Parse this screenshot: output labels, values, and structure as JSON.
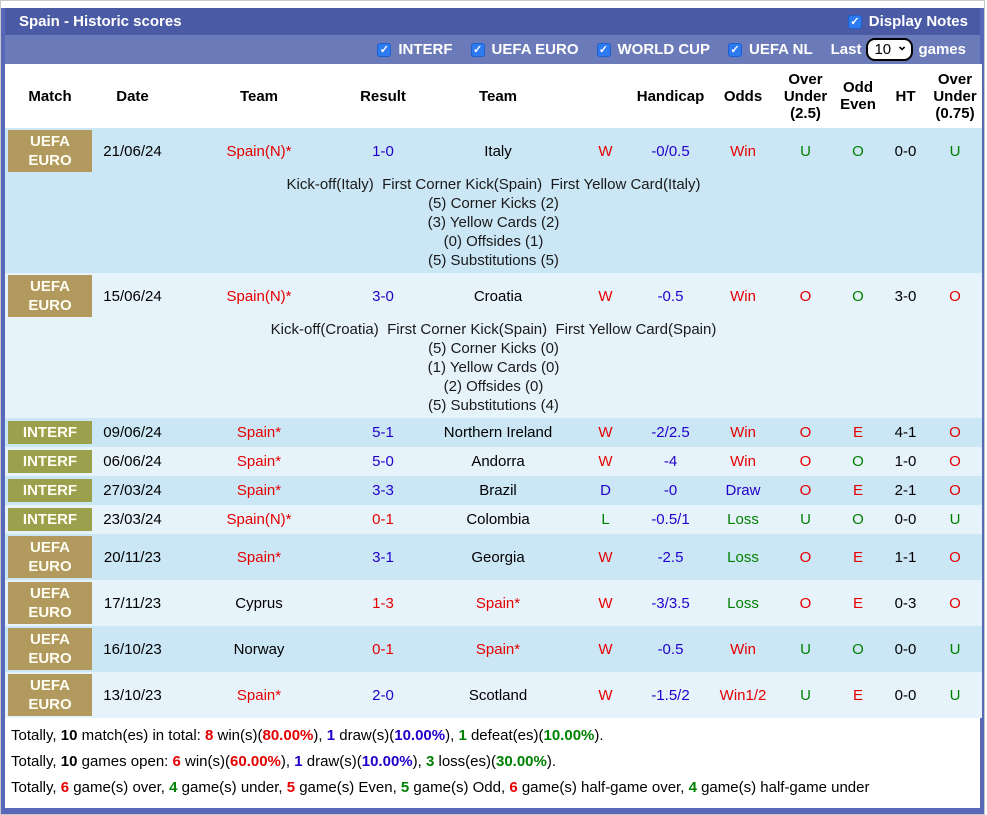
{
  "palette": {
    "r": "#e50000",
    "b": "#2200cc",
    "g": "#008000",
    "k": "#000000",
    "title_bar_bg": "#4a5aa5",
    "filter_bar_bg": "#6b7ab8",
    "border_blue": "#5868b8",
    "checkbox_blue": "#2e7bf0",
    "row_dark": "#cbe6f5",
    "row_light": "#e7f3fb",
    "badge_euro": "#b2995e",
    "badge_interf": "#9aa04b"
  },
  "header": {
    "title": "Spain - Historic scores",
    "display_notes_label": "Display Notes"
  },
  "filters": {
    "items": [
      "INTERF",
      "UEFA EURO",
      "WORLD CUP",
      "UEFA NL"
    ],
    "last_label": "Last",
    "last_value": "10",
    "games_label": "games"
  },
  "table": {
    "columns": [
      "Match",
      "Date",
      "Team",
      "Result",
      "Team",
      "",
      "Handicap",
      "Odds",
      "Over\nUnder\n(2.5)",
      "Odd\nEven",
      "HT",
      "Over\nUnder\n(0.75)"
    ]
  },
  "rows": [
    {
      "comp": "UEFA EURO",
      "comp_style": "euro",
      "shade": "dark",
      "date": "21/06/24",
      "team1": [
        "Spain(N)*",
        "r"
      ],
      "result": [
        "1-0",
        "b"
      ],
      "team2": [
        "Italy",
        "k"
      ],
      "wdl": [
        "W",
        "r"
      ],
      "handicap": [
        "-0/0.5",
        "b"
      ],
      "odds": [
        "Win",
        "r"
      ],
      "ou25": [
        "U",
        "g"
      ],
      "oe": [
        "O",
        "g"
      ],
      "ht": [
        "0-0",
        "k"
      ],
      "ou075": [
        "U",
        "g"
      ],
      "notes": [
        "Kick-off(Italy)  First Corner Kick(Spain)  First Yellow Card(Italy)",
        "(5) Corner Kicks (2)",
        "(3) Yellow Cards (2)",
        "(0) Offsides (1)",
        "(5) Substitutions (5)"
      ]
    },
    {
      "comp": "UEFA EURO",
      "comp_style": "euro",
      "shade": "light",
      "date": "15/06/24",
      "team1": [
        "Spain(N)*",
        "r"
      ],
      "result": [
        "3-0",
        "b"
      ],
      "team2": [
        "Croatia",
        "k"
      ],
      "wdl": [
        "W",
        "r"
      ],
      "handicap": [
        "-0.5",
        "b"
      ],
      "odds": [
        "Win",
        "r"
      ],
      "ou25": [
        "O",
        "r"
      ],
      "oe": [
        "O",
        "g"
      ],
      "ht": [
        "3-0",
        "k"
      ],
      "ou075": [
        "O",
        "r"
      ],
      "notes": [
        "Kick-off(Croatia)  First Corner Kick(Spain)  First Yellow Card(Spain)",
        "(5) Corner Kicks (0)",
        "(1) Yellow Cards (0)",
        "(2) Offsides (0)",
        "(5) Substitutions (4)"
      ]
    },
    {
      "comp": "INTERF",
      "comp_style": "interf",
      "shade": "dark",
      "date": "09/06/24",
      "team1": [
        "Spain*",
        "r"
      ],
      "result": [
        "5-1",
        "b"
      ],
      "team2": [
        "Northern Ireland",
        "k"
      ],
      "wdl": [
        "W",
        "r"
      ],
      "handicap": [
        "-2/2.5",
        "b"
      ],
      "odds": [
        "Win",
        "r"
      ],
      "ou25": [
        "O",
        "r"
      ],
      "oe": [
        "E",
        "r"
      ],
      "ht": [
        "4-1",
        "k"
      ],
      "ou075": [
        "O",
        "r"
      ],
      "notes": []
    },
    {
      "comp": "INTERF",
      "comp_style": "interf",
      "shade": "light",
      "date": "06/06/24",
      "team1": [
        "Spain*",
        "r"
      ],
      "result": [
        "5-0",
        "b"
      ],
      "team2": [
        "Andorra",
        "k"
      ],
      "wdl": [
        "W",
        "r"
      ],
      "handicap": [
        "-4",
        "b"
      ],
      "odds": [
        "Win",
        "r"
      ],
      "ou25": [
        "O",
        "r"
      ],
      "oe": [
        "O",
        "g"
      ],
      "ht": [
        "1-0",
        "k"
      ],
      "ou075": [
        "O",
        "r"
      ],
      "notes": []
    },
    {
      "comp": "INTERF",
      "comp_style": "interf",
      "shade": "dark",
      "date": "27/03/24",
      "team1": [
        "Spain*",
        "r"
      ],
      "result": [
        "3-3",
        "b"
      ],
      "team2": [
        "Brazil",
        "k"
      ],
      "wdl": [
        "D",
        "b"
      ],
      "handicap": [
        "-0",
        "b"
      ],
      "odds": [
        "Draw",
        "b"
      ],
      "ou25": [
        "O",
        "r"
      ],
      "oe": [
        "E",
        "r"
      ],
      "ht": [
        "2-1",
        "k"
      ],
      "ou075": [
        "O",
        "r"
      ],
      "notes": []
    },
    {
      "comp": "INTERF",
      "comp_style": "interf",
      "shade": "light",
      "date": "23/03/24",
      "team1": [
        "Spain(N)*",
        "r"
      ],
      "result": [
        "0-1",
        "r"
      ],
      "team2": [
        "Colombia",
        "k"
      ],
      "wdl": [
        "L",
        "g"
      ],
      "handicap": [
        "-0.5/1",
        "b"
      ],
      "odds": [
        "Loss",
        "g"
      ],
      "ou25": [
        "U",
        "g"
      ],
      "oe": [
        "O",
        "g"
      ],
      "ht": [
        "0-0",
        "k"
      ],
      "ou075": [
        "U",
        "g"
      ],
      "notes": []
    },
    {
      "comp": "UEFA EURO",
      "comp_style": "euro",
      "shade": "dark",
      "date": "20/11/23",
      "team1": [
        "Spain*",
        "r"
      ],
      "result": [
        "3-1",
        "b"
      ],
      "team2": [
        "Georgia",
        "k"
      ],
      "wdl": [
        "W",
        "r"
      ],
      "handicap": [
        "-2.5",
        "b"
      ],
      "odds": [
        "Loss",
        "g"
      ],
      "ou25": [
        "O",
        "r"
      ],
      "oe": [
        "E",
        "r"
      ],
      "ht": [
        "1-1",
        "k"
      ],
      "ou075": [
        "O",
        "r"
      ],
      "notes": []
    },
    {
      "comp": "UEFA EURO",
      "comp_style": "euro",
      "shade": "light",
      "date": "17/11/23",
      "team1": [
        "Cyprus",
        "k"
      ],
      "result": [
        "1-3",
        "r"
      ],
      "team2": [
        "Spain*",
        "r"
      ],
      "wdl": [
        "W",
        "r"
      ],
      "handicap": [
        "-3/3.5",
        "b"
      ],
      "odds": [
        "Loss",
        "g"
      ],
      "ou25": [
        "O",
        "r"
      ],
      "oe": [
        "E",
        "r"
      ],
      "ht": [
        "0-3",
        "k"
      ],
      "ou075": [
        "O",
        "r"
      ],
      "notes": []
    },
    {
      "comp": "UEFA EURO",
      "comp_style": "euro",
      "shade": "dark",
      "date": "16/10/23",
      "team1": [
        "Norway",
        "k"
      ],
      "result": [
        "0-1",
        "r"
      ],
      "team2": [
        "Spain*",
        "r"
      ],
      "wdl": [
        "W",
        "r"
      ],
      "handicap": [
        "-0.5",
        "b"
      ],
      "odds": [
        "Win",
        "r"
      ],
      "ou25": [
        "U",
        "g"
      ],
      "oe": [
        "O",
        "g"
      ],
      "ht": [
        "0-0",
        "k"
      ],
      "ou075": [
        "U",
        "g"
      ],
      "notes": []
    },
    {
      "comp": "UEFA EURO",
      "comp_style": "euro",
      "shade": "light",
      "date": "13/10/23",
      "team1": [
        "Spain*",
        "r"
      ],
      "result": [
        "2-0",
        "b"
      ],
      "team2": [
        "Scotland",
        "k"
      ],
      "wdl": [
        "W",
        "r"
      ],
      "handicap": [
        "-1.5/2",
        "b"
      ],
      "odds": [
        "Win1/2",
        "r"
      ],
      "ou25": [
        "U",
        "g"
      ],
      "oe": [
        "E",
        "r"
      ],
      "ht": [
        "0-0",
        "k"
      ],
      "ou075": [
        "U",
        "g"
      ],
      "notes": []
    }
  ],
  "summary": {
    "lines": [
      [
        {
          "t": "Totally, ",
          "c": "k"
        },
        {
          "t": "10",
          "c": "k",
          "b": 1
        },
        {
          "t": " match(es) in total: ",
          "c": "k"
        },
        {
          "t": "8",
          "c": "r",
          "b": 1
        },
        {
          "t": " win(s)(",
          "c": "k"
        },
        {
          "t": "80.00%",
          "c": "r",
          "b": 1
        },
        {
          "t": "), ",
          "c": "k"
        },
        {
          "t": "1",
          "c": "b",
          "b": 1
        },
        {
          "t": " draw(s)(",
          "c": "k"
        },
        {
          "t": "10.00%",
          "c": "b",
          "b": 1
        },
        {
          "t": "), ",
          "c": "k"
        },
        {
          "t": "1",
          "c": "g",
          "b": 1
        },
        {
          "t": " defeat(es)(",
          "c": "k"
        },
        {
          "t": "10.00%",
          "c": "g",
          "b": 1
        },
        {
          "t": ").",
          "c": "k"
        }
      ],
      [
        {
          "t": "Totally, ",
          "c": "k"
        },
        {
          "t": "10",
          "c": "k",
          "b": 1
        },
        {
          "t": " games open: ",
          "c": "k"
        },
        {
          "t": "6",
          "c": "r",
          "b": 1
        },
        {
          "t": " win(s)(",
          "c": "k"
        },
        {
          "t": "60.00%",
          "c": "r",
          "b": 1
        },
        {
          "t": "), ",
          "c": "k"
        },
        {
          "t": "1",
          "c": "b",
          "b": 1
        },
        {
          "t": " draw(s)(",
          "c": "k"
        },
        {
          "t": "10.00%",
          "c": "b",
          "b": 1
        },
        {
          "t": "), ",
          "c": "k"
        },
        {
          "t": "3",
          "c": "g",
          "b": 1
        },
        {
          "t": " loss(es)(",
          "c": "k"
        },
        {
          "t": "30.00%",
          "c": "g",
          "b": 1
        },
        {
          "t": ").",
          "c": "k"
        }
      ],
      [
        {
          "t": "Totally, ",
          "c": "k"
        },
        {
          "t": "6",
          "c": "r",
          "b": 1
        },
        {
          "t": " game(s) over, ",
          "c": "k"
        },
        {
          "t": "4",
          "c": "g",
          "b": 1
        },
        {
          "t": " game(s) under, ",
          "c": "k"
        },
        {
          "t": "5",
          "c": "r",
          "b": 1
        },
        {
          "t": " game(s) Even, ",
          "c": "k"
        },
        {
          "t": "5",
          "c": "g",
          "b": 1
        },
        {
          "t": " game(s) Odd, ",
          "c": "k"
        },
        {
          "t": "6",
          "c": "r",
          "b": 1
        },
        {
          "t": " game(s) half-game over, ",
          "c": "k"
        },
        {
          "t": "4",
          "c": "g",
          "b": 1
        },
        {
          "t": " game(s) half-game under",
          "c": "k"
        }
      ]
    ]
  }
}
